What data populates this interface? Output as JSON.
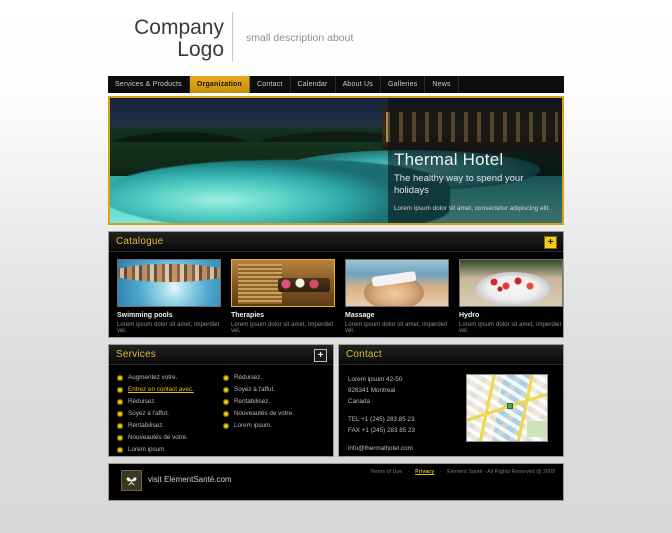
{
  "header": {
    "logo_line1": "Company",
    "logo_line2": "Logo",
    "tagline": "small description about"
  },
  "nav": {
    "items": [
      {
        "label": "Services & Products",
        "active": false
      },
      {
        "label": "Organization",
        "active": true
      },
      {
        "label": "Contact",
        "active": false
      },
      {
        "label": "Calendar",
        "active": false
      },
      {
        "label": "About Us",
        "active": false
      },
      {
        "label": "Galleries",
        "active": false
      },
      {
        "label": "News",
        "active": false
      }
    ]
  },
  "hero": {
    "title": "Thermal Hotel",
    "subtitle": "The healthy way to spend your holidays",
    "description": "Lorem ipsum dolor sit amet, consectetur adipiscing elit."
  },
  "catalogue": {
    "title": "Catalogue",
    "expand_icon": "plus-icon",
    "items": [
      {
        "name": "Swimming pools",
        "desc": "Lorem ipsum dolor sit amet, imperdiet vel.",
        "selected": false
      },
      {
        "name": "Therapies",
        "desc": "Lorem ipsum dolor sit amet, imperdiet vel.",
        "selected": true
      },
      {
        "name": "Massage",
        "desc": "Lorem ipsum dolor sit amet, imperdiet vel.",
        "selected": false
      },
      {
        "name": "Hydro",
        "desc": "Lorem ipsum dolor sit amet, imperdiet vel.",
        "selected": false
      }
    ]
  },
  "services": {
    "title": "Services",
    "expand_icon": "plus-icon",
    "column1": [
      {
        "label": "Augmentez votre.",
        "hover": false
      },
      {
        "label": "Entrez en contact avec.",
        "hover": true
      },
      {
        "label": "Réduisez.",
        "hover": false
      },
      {
        "label": "Soyez à l'affut.",
        "hover": false
      },
      {
        "label": "Rentabilisez.",
        "hover": false
      },
      {
        "label": "Nouveautés de votre.",
        "hover": false
      },
      {
        "label": "Lorem ipsum.",
        "hover": false
      }
    ],
    "column2": [
      {
        "label": "Réduisez.",
        "hover": false
      },
      {
        "label": "Soyez à l'affut.",
        "hover": false
      },
      {
        "label": "Rentabilisez.",
        "hover": false
      },
      {
        "label": "Nouveautés de votre.",
        "hover": false
      },
      {
        "label": "Lorem ipsum.",
        "hover": false
      }
    ]
  },
  "contact": {
    "title": "Contact",
    "address_line1": "Lorem ipsum 42-50",
    "address_line2": "926341 Montreal",
    "address_line3": "Canada",
    "tel": "TEL +1 (245) 283 85 23",
    "fax": "FAX +1 (245) 283 85 23",
    "email": "info@thermalhotel.com",
    "map_alt": "map-thumbnail"
  },
  "footer": {
    "logo_icon": "butterfly-icon",
    "visit": "visit ElementSanté.com",
    "terms": "Terms of Use",
    "privacy": "Privacy",
    "copyright": "Élément Santé - All Rights Reserved @ 2009"
  },
  "colors": {
    "gold": "#e3b63a",
    "gold_bright": "#f2d010",
    "nav_active": "#d79d13",
    "panel_bg": "#000000"
  }
}
